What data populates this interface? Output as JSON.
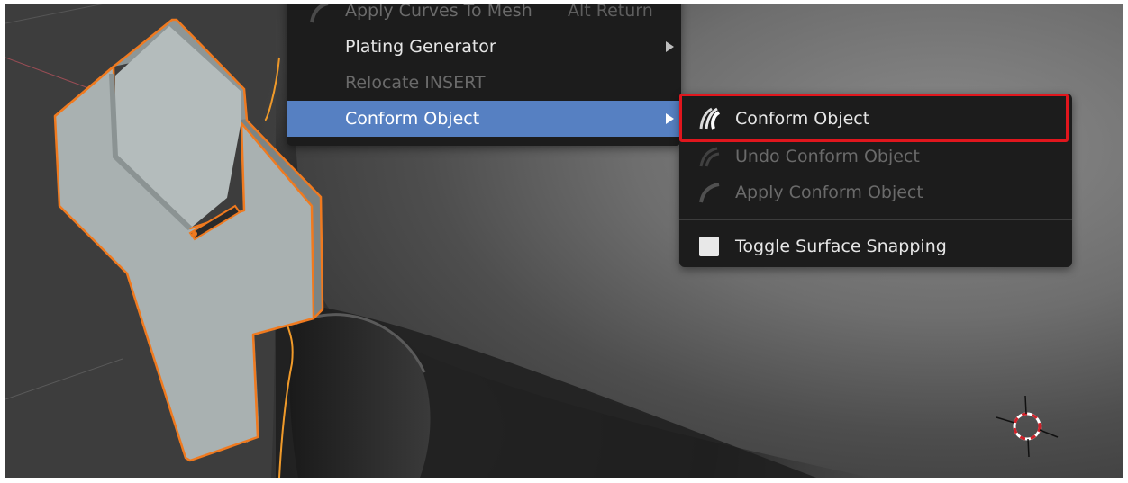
{
  "main_menu": {
    "items": [
      {
        "label": "Apply Curves To Mesh",
        "shortcut": "Alt Return",
        "state": "disabled"
      },
      {
        "label": "Plating Generator",
        "state": "normal",
        "submenu": true
      },
      {
        "label": "Relocate INSERT",
        "state": "disabled"
      },
      {
        "label": "Conform Object",
        "state": "active",
        "submenu": true
      }
    ]
  },
  "sub_menu": {
    "items": [
      {
        "label": "Conform Object",
        "icon": "conform-object-icon",
        "state": "highlighted"
      },
      {
        "label": "Undo Conform Object",
        "icon": "undo-conform-icon",
        "state": "disabled"
      },
      {
        "label": "Apply Conform Object",
        "icon": "apply-conform-icon",
        "state": "disabled"
      },
      {
        "label": "Toggle Surface Snapping",
        "icon": "checkbox-icon",
        "state": "normal"
      }
    ]
  },
  "colors": {
    "menu_bg": "#1c1c1c",
    "active_item": "#5680c2",
    "highlight_box": "#e0161d",
    "selection_outline": "#f07a1f"
  }
}
